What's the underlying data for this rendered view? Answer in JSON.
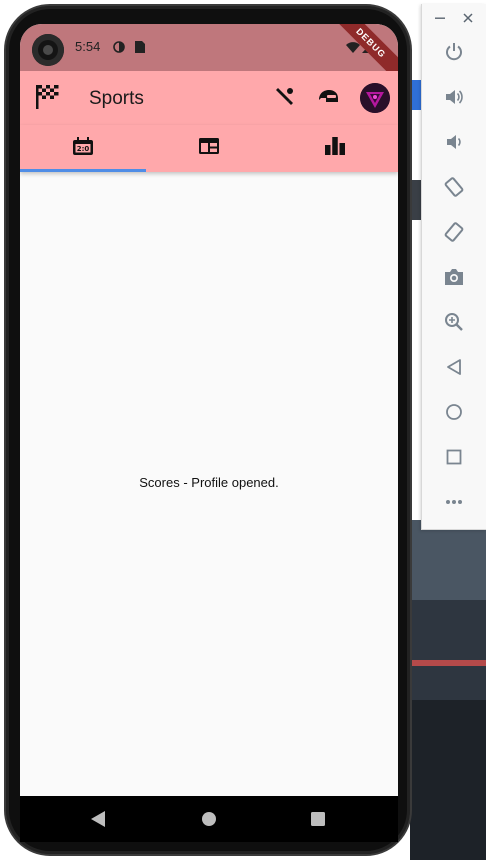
{
  "status_bar": {
    "time": "5:54",
    "debug_banner": "DEBUG",
    "color": "#bf777c"
  },
  "app_bar": {
    "title": "Sports",
    "leading_icon": "checkered-flag-icon",
    "actions": [
      "cricket-bat-icon",
      "helmet-icon",
      "avatar"
    ],
    "color": "#ffa8ab"
  },
  "tabs": {
    "items": [
      {
        "icon": "scoreboard-icon",
        "selected": true
      },
      {
        "icon": "schedule-icon",
        "selected": false
      },
      {
        "icon": "bar-chart-icon",
        "selected": false
      }
    ],
    "indicator_color": "#4f8de6"
  },
  "main": {
    "message": "Scores - Profile opened."
  },
  "nav_bar": {
    "buttons": [
      "back-icon",
      "home-icon",
      "recents-icon"
    ]
  },
  "emulator_toolbar": {
    "buttons": [
      "power-icon",
      "volume-up-icon",
      "volume-down-icon",
      "rotate-left-icon",
      "rotate-right-icon",
      "camera-icon",
      "zoom-icon",
      "back-icon",
      "home-icon",
      "overview-icon",
      "more-icon"
    ]
  }
}
